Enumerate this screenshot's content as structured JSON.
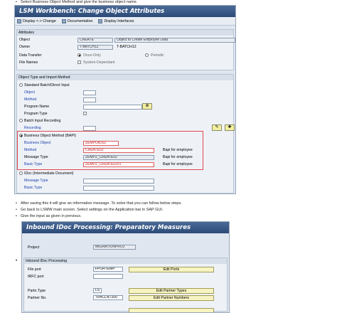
{
  "top_instruction": "Select Business Object Method and give the business object name.",
  "screen1": {
    "title": "LSM Workbench: Change Object Attributes",
    "toolbar": {
      "display_change": "Display <-> Change",
      "documentation": "Documentation",
      "display_interfaces": "Display Interfaces"
    },
    "attributes": {
      "header": "Attributes",
      "object_label": "Object",
      "object_value": "CREATE",
      "object_desc": "Object to Create Employee Data",
      "owner_label": "Owner",
      "owner_value": "T-BATCH12",
      "owner_desc": "T-BATCH12",
      "data_transfer_label": "Data Transfer",
      "once_only": "Once-Only",
      "periodic": "Periodic",
      "file_names_label": "File Names",
      "system_dependant": "System-Dependant"
    },
    "object_type": {
      "header": "Object Type and Import Method",
      "standard_batch": "Standard Batch/Direct Input",
      "object": "Object",
      "method": "Method",
      "program_name": "Program Name",
      "program_type": "Program Type",
      "batch_input_recording": "Batch Input Recording",
      "recording": "Recording",
      "bapi_label": "Business Object Method (BAPI)",
      "business_object_label": "Business Object",
      "business_object_value": "ZEMPOBJ02",
      "method_label": "Method",
      "method_value": "CREATE02",
      "method_desc": "Bapi for employee",
      "message_type_label": "Message Type",
      "message_type_value": "ZEMP2_CREATE02",
      "message_type_desc": "Bapi for employee",
      "basic_type_label": "Basic Type",
      "basic_type_value": "ZEMP2_CREATE0201",
      "basic_type_desc": "Bapi for employee",
      "idoc_label": "IDoc (Intermediate Document)",
      "idoc_message_type": "Message Type",
      "idoc_basic_type": "Basic Type"
    }
  },
  "bullets": [
    "After saving this it will give an information message. To solve that you can follow below steps.",
    "Go back to LSMW main screen. Select settings on the Application bar in SAP GUI.",
    "Give the input as given in previous."
  ],
  "screen2": {
    "title": "Inbound IDoc Processing: Preparatory Measures",
    "project_label": "Project",
    "project_value": "MIGRATIONPROJ",
    "section": "Inbound IDoc Processing",
    "file_port_label": "File port",
    "file_port_value": "FPORTEMP",
    "edit_ports": "Edit Ports",
    "trfc_port_label": "tRFC port",
    "partn_type_label": "Partn.Type",
    "partn_type_value": "LS",
    "edit_partner_types": "Edit Partner Types",
    "partner_no_label": "Partner No.",
    "partner_no_value": "TR4CLNT200",
    "edit_partner_numbers": "Edit Partner Numbers"
  }
}
